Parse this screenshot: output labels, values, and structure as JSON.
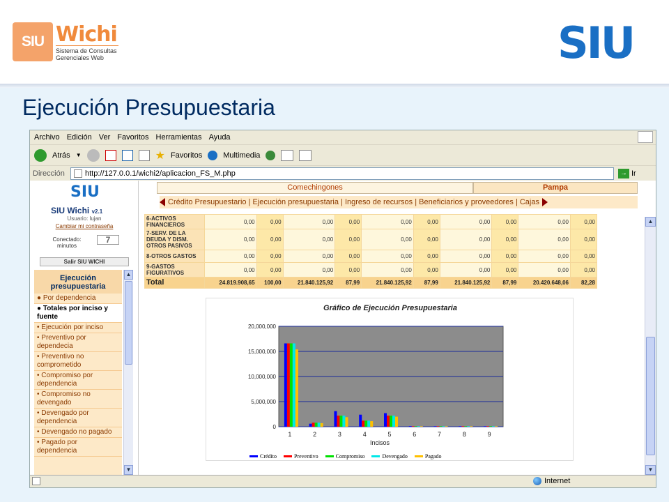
{
  "header": {
    "logo_left": {
      "mark": "SIU",
      "name": "Wichi",
      "subtitle_line1": "Sistema de Consultas",
      "subtitle_line2": "Gerenciales Web"
    },
    "logo_right": "SIU",
    "title": "Ejecución Presupuestaria"
  },
  "browser": {
    "menu": [
      "Archivo",
      "Edición",
      "Ver",
      "Favoritos",
      "Herramientas",
      "Ayuda"
    ],
    "toolbar": {
      "back": "Atrás",
      "favorites": "Favoritos",
      "multimedia": "Multimedia"
    },
    "address_label": "Dirección",
    "url": "http://127.0.0.1/wichi2/aplicacion_FS_M.php",
    "go_label": "Ir",
    "status_zone": "Internet"
  },
  "sidebar": {
    "logo": "SIU",
    "app_name": "SIU  Wichi",
    "version": "v2.1",
    "user": "Usuario: lujan",
    "change_password": "Cambiar mi contraseña",
    "connected_label": "Conectado:",
    "minutes_label": "minutos",
    "minutes": "7",
    "exit": "Salir SIU WICHI",
    "menu_title": "Ejecución presupuestaria",
    "items": [
      {
        "label": "Por dependencia",
        "selected": false
      },
      {
        "label": "Totales por inciso y fuente",
        "selected": true
      },
      {
        "label": "Ejecución por inciso",
        "selected": false
      },
      {
        "label": "Preventivo por dependecia",
        "selected": false
      },
      {
        "label": "Preventivo no comprometido",
        "selected": false
      },
      {
        "label": "Compromiso por dependencia",
        "selected": false
      },
      {
        "label": "Compromiso no devengado",
        "selected": false
      },
      {
        "label": "Devengado por dependencia",
        "selected": false
      },
      {
        "label": "Devengado no pagado",
        "selected": false
      },
      {
        "label": "Pagado por dependencia",
        "selected": false
      }
    ]
  },
  "tabs": [
    "Comechingones",
    "Pampa"
  ],
  "subnav": "Crédito Presupuestario | Ejecución presupuestaria | Ingreso de recursos | Beneficiarios y proveedores | Cajas",
  "table": {
    "rows": [
      {
        "label": "6-ACTIVOS FINANCIEROS",
        "values": [
          "0,00",
          "0,00",
          "0,00",
          "0,00",
          "0,00",
          "0,00",
          "0,00",
          "0,00",
          "0,00",
          "0,00"
        ]
      },
      {
        "label": "7-SERV. DE LA DEUDA Y DISM. OTROS PASIVOS",
        "values": [
          "0,00",
          "0,00",
          "0,00",
          "0,00",
          "0,00",
          "0,00",
          "0,00",
          "0,00",
          "0,00",
          "0,00"
        ]
      },
      {
        "label": "8-OTROS GASTOS",
        "values": [
          "0,00",
          "0,00",
          "0,00",
          "0,00",
          "0,00",
          "0,00",
          "0,00",
          "0,00",
          "0,00",
          "0,00"
        ]
      },
      {
        "label": "9-GASTOS FIGURATIVOS",
        "values": [
          "0,00",
          "0,00",
          "0,00",
          "0,00",
          "0,00",
          "0,00",
          "0,00",
          "0,00",
          "0,00",
          "0,00"
        ]
      }
    ],
    "total": {
      "label": "Total",
      "values": [
        "24.819.908,65",
        "100,00",
        "21.840.125,92",
        "87,99",
        "21.840.125,92",
        "87,99",
        "21.840.125,92",
        "87,99",
        "20.420.648,06",
        "82,28"
      ]
    }
  },
  "chart_data": {
    "type": "bar",
    "title": "Gráfico de Ejecución Presupuestaria",
    "xlabel": "Incisos",
    "ylabel": "",
    "categories": [
      "1",
      "2",
      "3",
      "4",
      "5",
      "6",
      "7",
      "8",
      "9"
    ],
    "ylim": [
      0,
      20000000
    ],
    "yticks": [
      "0",
      "5,000,000",
      "10,000,000",
      "15,000,000",
      "20,000,000"
    ],
    "grid": true,
    "legend": "bottom",
    "series": [
      {
        "name": "Crédito",
        "color": "#0000ff",
        "values": [
          16600000,
          600000,
          3100000,
          2400000,
          2700000,
          120000,
          100000,
          100000,
          100000
        ]
      },
      {
        "name": "Preventivo",
        "color": "#ff0000",
        "values": [
          16600000,
          800000,
          2200000,
          1200000,
          2200000,
          100000,
          100000,
          100000,
          100000
        ]
      },
      {
        "name": "Compromiso",
        "color": "#00e000",
        "values": [
          16600000,
          800000,
          2200000,
          1200000,
          2200000,
          100000,
          100000,
          100000,
          100000
        ]
      },
      {
        "name": "Devengado",
        "color": "#00e8e8",
        "values": [
          16600000,
          800000,
          2200000,
          1200000,
          2200000,
          100000,
          100000,
          100000,
          100000
        ]
      },
      {
        "name": "Pagado",
        "color": "#ffc000",
        "values": [
          15400000,
          700000,
          1900000,
          1100000,
          2000000,
          100000,
          100000,
          100000,
          100000
        ]
      }
    ]
  }
}
